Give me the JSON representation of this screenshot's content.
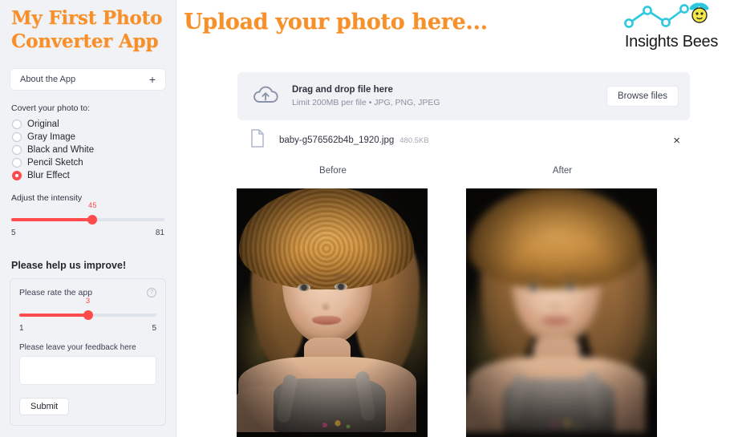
{
  "sidebar": {
    "app_title": "My First Photo Converter App",
    "expander": {
      "label": "About the App",
      "toggle": "+"
    },
    "convert_label": "Covert your photo to:",
    "options": [
      {
        "label": "Original",
        "selected": false
      },
      {
        "label": "Gray Image",
        "selected": false
      },
      {
        "label": "Black and White",
        "selected": false
      },
      {
        "label": "Pencil Sketch",
        "selected": false
      },
      {
        "label": "Blur Effect",
        "selected": true
      }
    ],
    "intensity_slider": {
      "caption": "Adjust the intensity",
      "value": "45",
      "min": "5",
      "max": "81",
      "percent": 53
    },
    "improve_title": "Please help us improve!",
    "feedback": {
      "rate_label": "Please rate the app",
      "help_icon": "?",
      "rating_slider": {
        "value": "3",
        "min": "1",
        "max": "5",
        "percent": 50
      },
      "text_label": "Please leave your feedback here",
      "textarea_value": "",
      "textarea_placeholder": "",
      "submit_label": "Submit"
    }
  },
  "main": {
    "title": "Upload your photo here...",
    "logo_text": "Insights Bees",
    "dropzone": {
      "icon": "cloud-upload-icon",
      "main_text": "Drag and drop file here",
      "sub_text": "Limit 200MB per file • JPG, PNG, JPEG",
      "browse_label": "Browse files"
    },
    "file": {
      "icon": "file-icon",
      "name": "baby-g576562b4b_1920.jpg",
      "size": "480.5KB",
      "remove_icon": "×"
    },
    "comparison": {
      "before_label": "Before",
      "after_label": "After"
    }
  },
  "colors": {
    "brand_orange": "#f7902b",
    "accent_red": "#ff4b4b",
    "sidebar_bg": "#f0f2f6",
    "logo_cyan": "#2cc8dd",
    "bee_yellow": "#f5e84a"
  }
}
